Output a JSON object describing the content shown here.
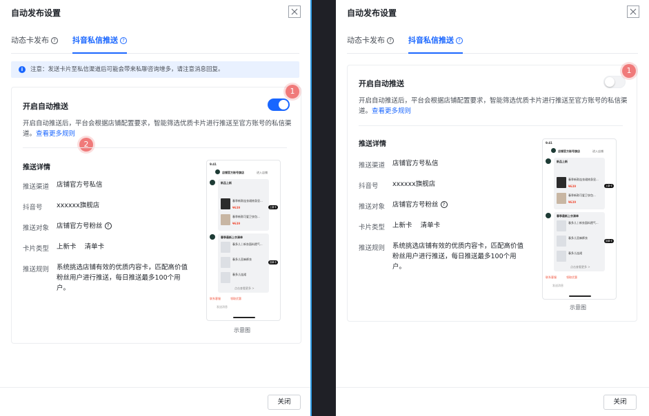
{
  "dialog": {
    "title": "自动发布设置",
    "tabs": [
      {
        "label": "动态卡发布"
      },
      {
        "label": "抖音私信推送"
      }
    ],
    "notice": "注意：发送卡片至私信渠道后可能会带来私聊咨询增多，请注意消息回复。",
    "card": {
      "title": "开启自动推送",
      "description": "开启自动推送后，平台会根据店铺配置要求，智能筛选优质卡片进行推送至官方账号的私信渠道。",
      "more_link": "查看更多规则"
    },
    "details": {
      "title": "推送详情",
      "rows": [
        {
          "label": "推送渠道",
          "value": "店铺官方号私信"
        },
        {
          "label": "抖音号",
          "value": "xxxxxx旗舰店"
        },
        {
          "label": "推送对象",
          "value": "店铺官方号粉丝"
        },
        {
          "label": "卡片类型",
          "value": "上新卡    清单卡"
        },
        {
          "label": "推送规则",
          "value": "系统挑选店铺有效的优质内容卡，匹配高价值粉丝用户进行推送，每日推送最多100个用户。"
        }
      ]
    },
    "preview_caption": "示意图",
    "close_button": "关闭"
  },
  "panels": {
    "left": {
      "toggle_on": true,
      "markers": [
        "1",
        "2"
      ]
    },
    "right": {
      "toggle_on": false,
      "markers": [
        "1"
      ]
    }
  },
  "phone": {
    "time": "9:41",
    "shop_name": "店铺官方账号旗店",
    "enter_shop": "进入店铺",
    "new_card_title": "新品上新",
    "new_card_sub": "最新到商品新款店内的，店铺最新新商品推荐",
    "product_1": "春季新款连衣裙修身显...",
    "product_2": "春季新款可爱卫衣包...",
    "price": "¥639",
    "list_card_title": "春季最新上衣清单",
    "product_3": "春多儿 | 新衣面料透气...",
    "product_4": "春多儿亚麻裤衣",
    "product_5": "春多儿连裙",
    "tag_new": "上新卡",
    "tag_list": "清单卡",
    "view_more": "点击查看更多 >",
    "chip_1": "联系客服",
    "chip_2": "领取优惠",
    "input_placeholder": "发送消息"
  },
  "colors": {
    "accent": "#1966ff",
    "marker": "#f07a7a",
    "notice_bg": "#e9f1ff",
    "price": "#f0553f"
  }
}
